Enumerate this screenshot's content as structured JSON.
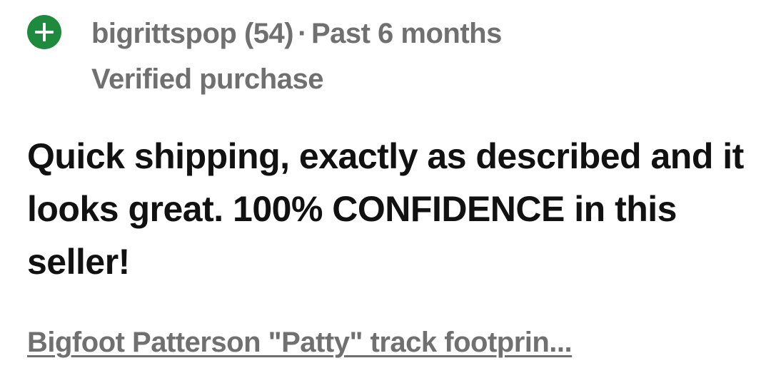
{
  "review": {
    "rating_icon": "plus-circle-icon",
    "rating_color": "#1e8a3e",
    "username": "bigrittspop",
    "feedback_score": "(54)",
    "separator": "·",
    "time_ago": "Past 6 months",
    "verified_label": "Verified purchase",
    "comment": "Quick shipping, exactly as described and it looks great. 100% CONFIDENCE in this seller!",
    "item_title": "Bigfoot Patterson \"Patty\" track footprin..."
  }
}
